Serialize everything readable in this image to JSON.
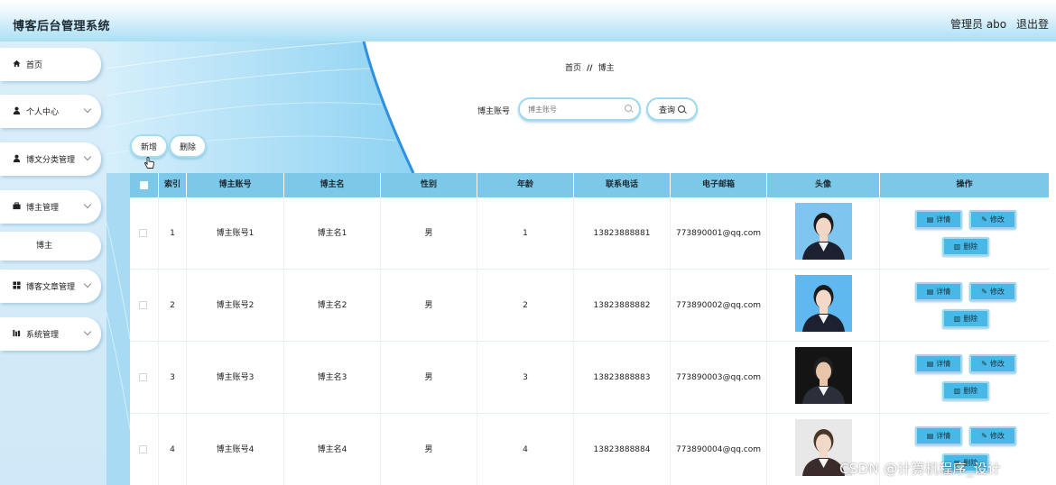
{
  "header": {
    "app_title": "博客后台管理系统",
    "admin_label": "管理员 abo",
    "logout_label": "退出登"
  },
  "sidebar": {
    "items": [
      {
        "label": "首页",
        "icon": "home-icon"
      },
      {
        "label": "个人中心",
        "icon": "user-icon"
      },
      {
        "label": "博文分类管理",
        "icon": "user-icon"
      },
      {
        "label": "博主管理",
        "icon": "briefcase-icon"
      },
      {
        "label": "博客文章管理",
        "icon": "grid-icon"
      },
      {
        "label": "系统管理",
        "icon": "chart-icon"
      }
    ],
    "sub_item": "博主"
  },
  "breadcrumb": {
    "home": "首页",
    "separator": "//",
    "current": "博主"
  },
  "search": {
    "label": "博主账号",
    "placeholder": "博主账号",
    "button_label": "查询"
  },
  "toolbar": {
    "add_label": "新增",
    "delete_label": "删除"
  },
  "table": {
    "headers": [
      "索引",
      "博主账号",
      "博主名",
      "性别",
      "年龄",
      "联系电话",
      "电子邮箱",
      "头像",
      "操作"
    ],
    "rows": [
      {
        "index": "1",
        "account": "博主账号1",
        "name": "博主名1",
        "gender": "男",
        "age": "1",
        "phone": "13823888881",
        "email": "773890001@qq.com"
      },
      {
        "index": "2",
        "account": "博主账号2",
        "name": "博主名2",
        "gender": "男",
        "age": "2",
        "phone": "13823888882",
        "email": "773890002@qq.com"
      },
      {
        "index": "3",
        "account": "博主账号3",
        "name": "博主名3",
        "gender": "男",
        "age": "3",
        "phone": "13823888883",
        "email": "773890003@qq.com"
      },
      {
        "index": "4",
        "account": "博主账号4",
        "name": "博主名4",
        "gender": "男",
        "age": "4",
        "phone": "13823888884",
        "email": "773890004@qq.com"
      }
    ],
    "actions": {
      "detail": "详情",
      "edit": "修改",
      "delete": "删除"
    }
  },
  "watermark": "CSDN @计算机程序_设计",
  "colors": {
    "header_bg": "#a9dff5",
    "table_header": "#7cc8e8",
    "action_button": "#48b9e6",
    "sidebar_bg": "#d9eef9"
  }
}
